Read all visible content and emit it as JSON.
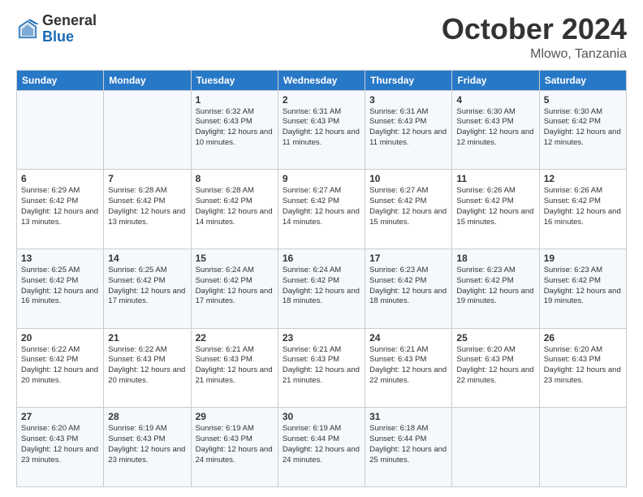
{
  "header": {
    "logo_general": "General",
    "logo_blue": "Blue",
    "month_title": "October 2024",
    "location": "Mlowo, Tanzania"
  },
  "weekdays": [
    "Sunday",
    "Monday",
    "Tuesday",
    "Wednesday",
    "Thursday",
    "Friday",
    "Saturday"
  ],
  "weeks": [
    [
      {
        "day": "",
        "info": ""
      },
      {
        "day": "",
        "info": ""
      },
      {
        "day": "1",
        "info": "Sunrise: 6:32 AM\nSunset: 6:43 PM\nDaylight: 12 hours and 10 minutes."
      },
      {
        "day": "2",
        "info": "Sunrise: 6:31 AM\nSunset: 6:43 PM\nDaylight: 12 hours and 11 minutes."
      },
      {
        "day": "3",
        "info": "Sunrise: 6:31 AM\nSunset: 6:43 PM\nDaylight: 12 hours and 11 minutes."
      },
      {
        "day": "4",
        "info": "Sunrise: 6:30 AM\nSunset: 6:43 PM\nDaylight: 12 hours and 12 minutes."
      },
      {
        "day": "5",
        "info": "Sunrise: 6:30 AM\nSunset: 6:42 PM\nDaylight: 12 hours and 12 minutes."
      }
    ],
    [
      {
        "day": "6",
        "info": "Sunrise: 6:29 AM\nSunset: 6:42 PM\nDaylight: 12 hours and 13 minutes."
      },
      {
        "day": "7",
        "info": "Sunrise: 6:28 AM\nSunset: 6:42 PM\nDaylight: 12 hours and 13 minutes."
      },
      {
        "day": "8",
        "info": "Sunrise: 6:28 AM\nSunset: 6:42 PM\nDaylight: 12 hours and 14 minutes."
      },
      {
        "day": "9",
        "info": "Sunrise: 6:27 AM\nSunset: 6:42 PM\nDaylight: 12 hours and 14 minutes."
      },
      {
        "day": "10",
        "info": "Sunrise: 6:27 AM\nSunset: 6:42 PM\nDaylight: 12 hours and 15 minutes."
      },
      {
        "day": "11",
        "info": "Sunrise: 6:26 AM\nSunset: 6:42 PM\nDaylight: 12 hours and 15 minutes."
      },
      {
        "day": "12",
        "info": "Sunrise: 6:26 AM\nSunset: 6:42 PM\nDaylight: 12 hours and 16 minutes."
      }
    ],
    [
      {
        "day": "13",
        "info": "Sunrise: 6:25 AM\nSunset: 6:42 PM\nDaylight: 12 hours and 16 minutes."
      },
      {
        "day": "14",
        "info": "Sunrise: 6:25 AM\nSunset: 6:42 PM\nDaylight: 12 hours and 17 minutes."
      },
      {
        "day": "15",
        "info": "Sunrise: 6:24 AM\nSunset: 6:42 PM\nDaylight: 12 hours and 17 minutes."
      },
      {
        "day": "16",
        "info": "Sunrise: 6:24 AM\nSunset: 6:42 PM\nDaylight: 12 hours and 18 minutes."
      },
      {
        "day": "17",
        "info": "Sunrise: 6:23 AM\nSunset: 6:42 PM\nDaylight: 12 hours and 18 minutes."
      },
      {
        "day": "18",
        "info": "Sunrise: 6:23 AM\nSunset: 6:42 PM\nDaylight: 12 hours and 19 minutes."
      },
      {
        "day": "19",
        "info": "Sunrise: 6:23 AM\nSunset: 6:42 PM\nDaylight: 12 hours and 19 minutes."
      }
    ],
    [
      {
        "day": "20",
        "info": "Sunrise: 6:22 AM\nSunset: 6:42 PM\nDaylight: 12 hours and 20 minutes."
      },
      {
        "day": "21",
        "info": "Sunrise: 6:22 AM\nSunset: 6:43 PM\nDaylight: 12 hours and 20 minutes."
      },
      {
        "day": "22",
        "info": "Sunrise: 6:21 AM\nSunset: 6:43 PM\nDaylight: 12 hours and 21 minutes."
      },
      {
        "day": "23",
        "info": "Sunrise: 6:21 AM\nSunset: 6:43 PM\nDaylight: 12 hours and 21 minutes."
      },
      {
        "day": "24",
        "info": "Sunrise: 6:21 AM\nSunset: 6:43 PM\nDaylight: 12 hours and 22 minutes."
      },
      {
        "day": "25",
        "info": "Sunrise: 6:20 AM\nSunset: 6:43 PM\nDaylight: 12 hours and 22 minutes."
      },
      {
        "day": "26",
        "info": "Sunrise: 6:20 AM\nSunset: 6:43 PM\nDaylight: 12 hours and 23 minutes."
      }
    ],
    [
      {
        "day": "27",
        "info": "Sunrise: 6:20 AM\nSunset: 6:43 PM\nDaylight: 12 hours and 23 minutes."
      },
      {
        "day": "28",
        "info": "Sunrise: 6:19 AM\nSunset: 6:43 PM\nDaylight: 12 hours and 23 minutes."
      },
      {
        "day": "29",
        "info": "Sunrise: 6:19 AM\nSunset: 6:43 PM\nDaylight: 12 hours and 24 minutes."
      },
      {
        "day": "30",
        "info": "Sunrise: 6:19 AM\nSunset: 6:44 PM\nDaylight: 12 hours and 24 minutes."
      },
      {
        "day": "31",
        "info": "Sunrise: 6:18 AM\nSunset: 6:44 PM\nDaylight: 12 hours and 25 minutes."
      },
      {
        "day": "",
        "info": ""
      },
      {
        "day": "",
        "info": ""
      }
    ]
  ]
}
